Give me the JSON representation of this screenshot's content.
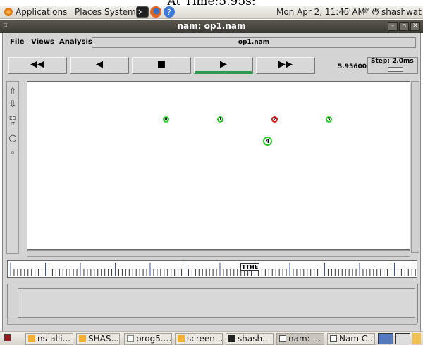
{
  "caption": "At Time:5.95s:",
  "top_panel": {
    "menus": [
      "Applications",
      "Places",
      "System"
    ],
    "clock": "Mon Apr  2, 11:45 AM",
    "user": "shashwat"
  },
  "window": {
    "title": "nam: op1.nam",
    "menu_items": [
      "File",
      "Views",
      "Analysis"
    ],
    "filename": "op1.nam",
    "controls": [
      "◀◀",
      "◀",
      "■",
      "▶",
      "▶▶"
    ],
    "time": "5.956000",
    "step": "Step: 2.0ms"
  },
  "tools": [
    "⇧",
    "⇩",
    "ED IT",
    "○",
    "◦"
  ],
  "nodes": [
    {
      "id": "0",
      "color": "#2ecc2e"
    },
    {
      "id": "1",
      "color": "#2ecc2e"
    },
    {
      "id": "2",
      "color": "#e01b1b"
    },
    {
      "id": "3",
      "color": "#2ecc2e"
    },
    {
      "id": "4",
      "color": "#2ecc2e"
    }
  ],
  "timeline": {
    "marker": "TTHE"
  },
  "taskbar": [
    "ns-alli...",
    "SHAS...",
    "prog5....",
    "screen...",
    "shash...",
    "nam: ...",
    "Nam C..."
  ]
}
